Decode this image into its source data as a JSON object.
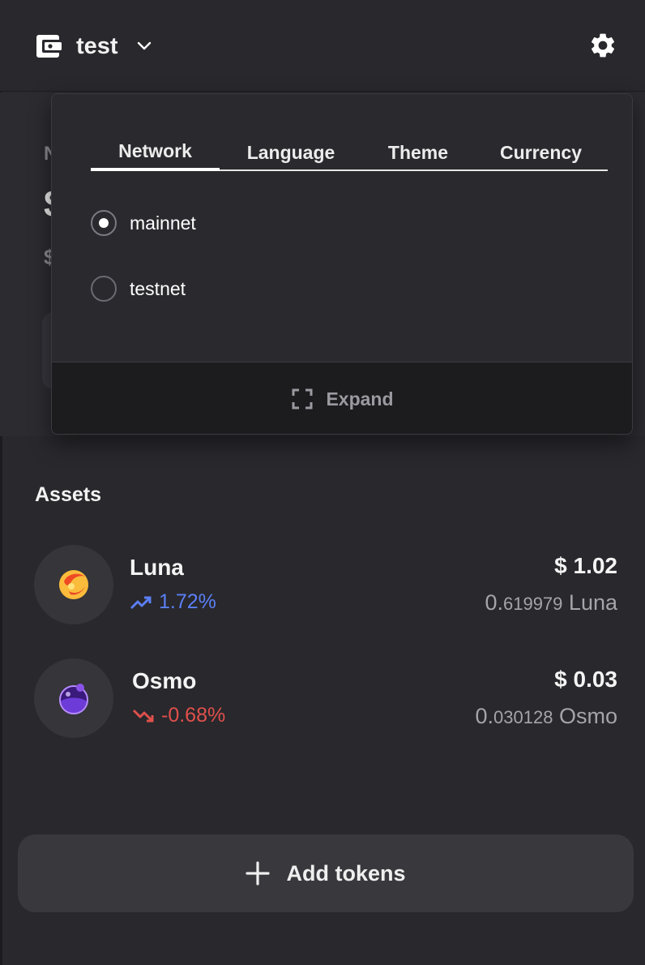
{
  "header": {
    "wallet_name": "test",
    "icons": {
      "wallet": "wallet-icon",
      "dropdown": "chevron-down-icon",
      "settings": "gear-icon"
    }
  },
  "settings_popover": {
    "tabs": [
      {
        "label": "Network",
        "active": true
      },
      {
        "label": "Language",
        "active": false
      },
      {
        "label": "Theme",
        "active": false
      },
      {
        "label": "Currency",
        "active": false
      }
    ],
    "network_options": [
      {
        "label": "mainnet",
        "selected": true
      },
      {
        "label": "testnet",
        "selected": false
      }
    ],
    "expand_label": "Expand"
  },
  "assets": {
    "title": "Assets",
    "items": [
      {
        "name": "Luna",
        "change": "1.72%",
        "direction": "up",
        "value": "$ 1.02",
        "amount_int": "0.",
        "amount_dec": "619979",
        "amount_unit": "Luna",
        "color": "#5b7ff5"
      },
      {
        "name": "Osmo",
        "change": "-0.68%",
        "direction": "down",
        "value": "$ 0.03",
        "amount_int": "0.",
        "amount_dec": "030128",
        "amount_unit": "Osmo",
        "color": "#e0504a"
      }
    ]
  },
  "add_tokens_label": "Add tokens"
}
